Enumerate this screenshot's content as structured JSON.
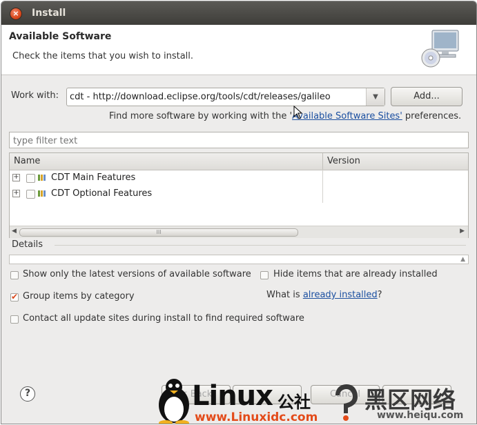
{
  "window": {
    "title": "Install"
  },
  "header": {
    "title": "Available Software",
    "description": "Check the items that you wish to install."
  },
  "work_with": {
    "label": "Work with:",
    "value": "cdt - http://download.eclipse.org/tools/cdt/releases/galileo",
    "add_label": "Add...",
    "find_more_prefix": "Find more software by working with the '",
    "find_more_link": "Available Software Sites'",
    "find_more_suffix": " preferences."
  },
  "filter": {
    "placeholder": "type filter text"
  },
  "tree": {
    "columns": [
      "Name",
      "Version"
    ],
    "rows": [
      {
        "label": "CDT Main Features",
        "version": ""
      },
      {
        "label": "CDT Optional Features",
        "version": ""
      }
    ],
    "scroll_grip": "III"
  },
  "details": {
    "label": "Details"
  },
  "options": {
    "show_latest": {
      "label": "Show only the latest versions of available software",
      "checked": false
    },
    "hide_installed": {
      "label": "Hide items that are already installed",
      "checked": false
    },
    "group_by_category": {
      "label": "Group items by category",
      "checked": true
    },
    "what_is_prefix": "What is ",
    "what_is_link": "already installed",
    "what_is_suffix": "?",
    "contact_all": {
      "label": "Contact all update sites during install to find required software",
      "checked": false
    }
  },
  "footer": {
    "help_icon": "?",
    "back_label": "< Back",
    "cancel_label": "Cancel"
  },
  "watermark": {
    "brand": "Linux",
    "brand_cn": "公社",
    "url": "www.Linuxidc.com",
    "right_cn": "黑区网络",
    "right_url": "www.heiqu.com"
  },
  "colors": {
    "accent": "#d9481c",
    "link": "#1b4fa0",
    "titlebar": "#3e3d39"
  }
}
